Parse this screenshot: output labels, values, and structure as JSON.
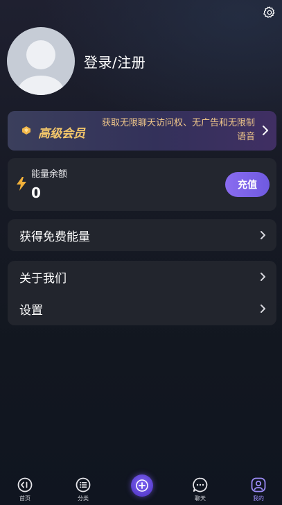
{
  "profile": {
    "login_text": "登录/注册"
  },
  "vip": {
    "title": "高级会员",
    "description": "获取无限聊天访问权、无广告和无限制语音"
  },
  "energy": {
    "label": "能量余额",
    "value": "0",
    "recharge_label": "充值"
  },
  "menu": {
    "free_energy": "获得免费能量",
    "about": "关于我们",
    "settings": "设置"
  },
  "tabs": [
    {
      "label": "首页",
      "icon": "home-icon"
    },
    {
      "label": "分类",
      "icon": "category-icon"
    },
    {
      "label": "",
      "icon": "plus-icon"
    },
    {
      "label": "聊天",
      "icon": "chat-icon"
    },
    {
      "label": "我的",
      "icon": "profile-icon"
    }
  ],
  "colors": {
    "accent": "#7e64f2",
    "vip_gold": "#f4c76a",
    "energy_bolt": "#f2b13a"
  }
}
